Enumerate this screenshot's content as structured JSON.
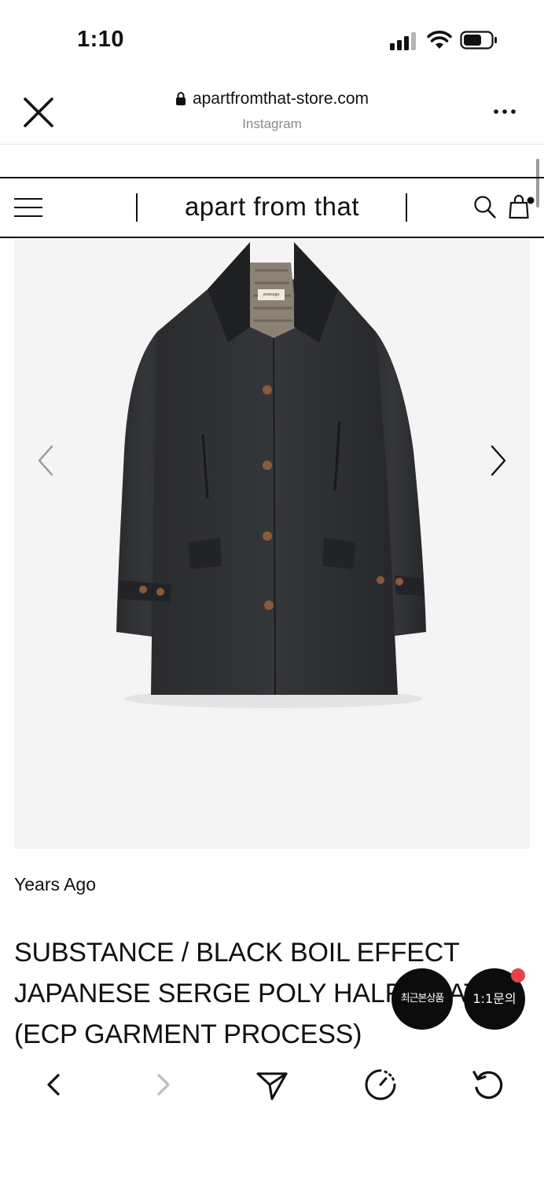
{
  "status_bar": {
    "time": "1:10"
  },
  "browser": {
    "url": "apartfromthat-store.com",
    "source": "Instagram"
  },
  "site": {
    "logo_text": "apart from that"
  },
  "product": {
    "image_label_text": "yearsago",
    "brand": "Years Ago",
    "title_lines": [
      "SUBSTANCE / BLACK BOIL EFFECT",
      "JAPANESE SERGE POLY HALF COAT",
      "(ECP GARMENT PROCESS)"
    ]
  },
  "floating": {
    "recent_label": "최근본상품",
    "inquiry_label": "1:1문의"
  },
  "icons": {
    "close": "close-icon",
    "lock": "lock-icon",
    "more": "more-icon",
    "menu": "menu-icon",
    "search": "search-icon",
    "cart": "shopping-bag-icon",
    "prev": "chevron-left-icon",
    "next": "chevron-right-icon",
    "back": "back-icon",
    "forward": "forward-icon",
    "share": "send-icon",
    "timer": "timer-icon",
    "reload": "reload-icon"
  },
  "colors": {
    "notification_dot": "#e8424d",
    "floating_button_bg": "#0c0c0c",
    "secondary_text": "#8a8a8a"
  }
}
